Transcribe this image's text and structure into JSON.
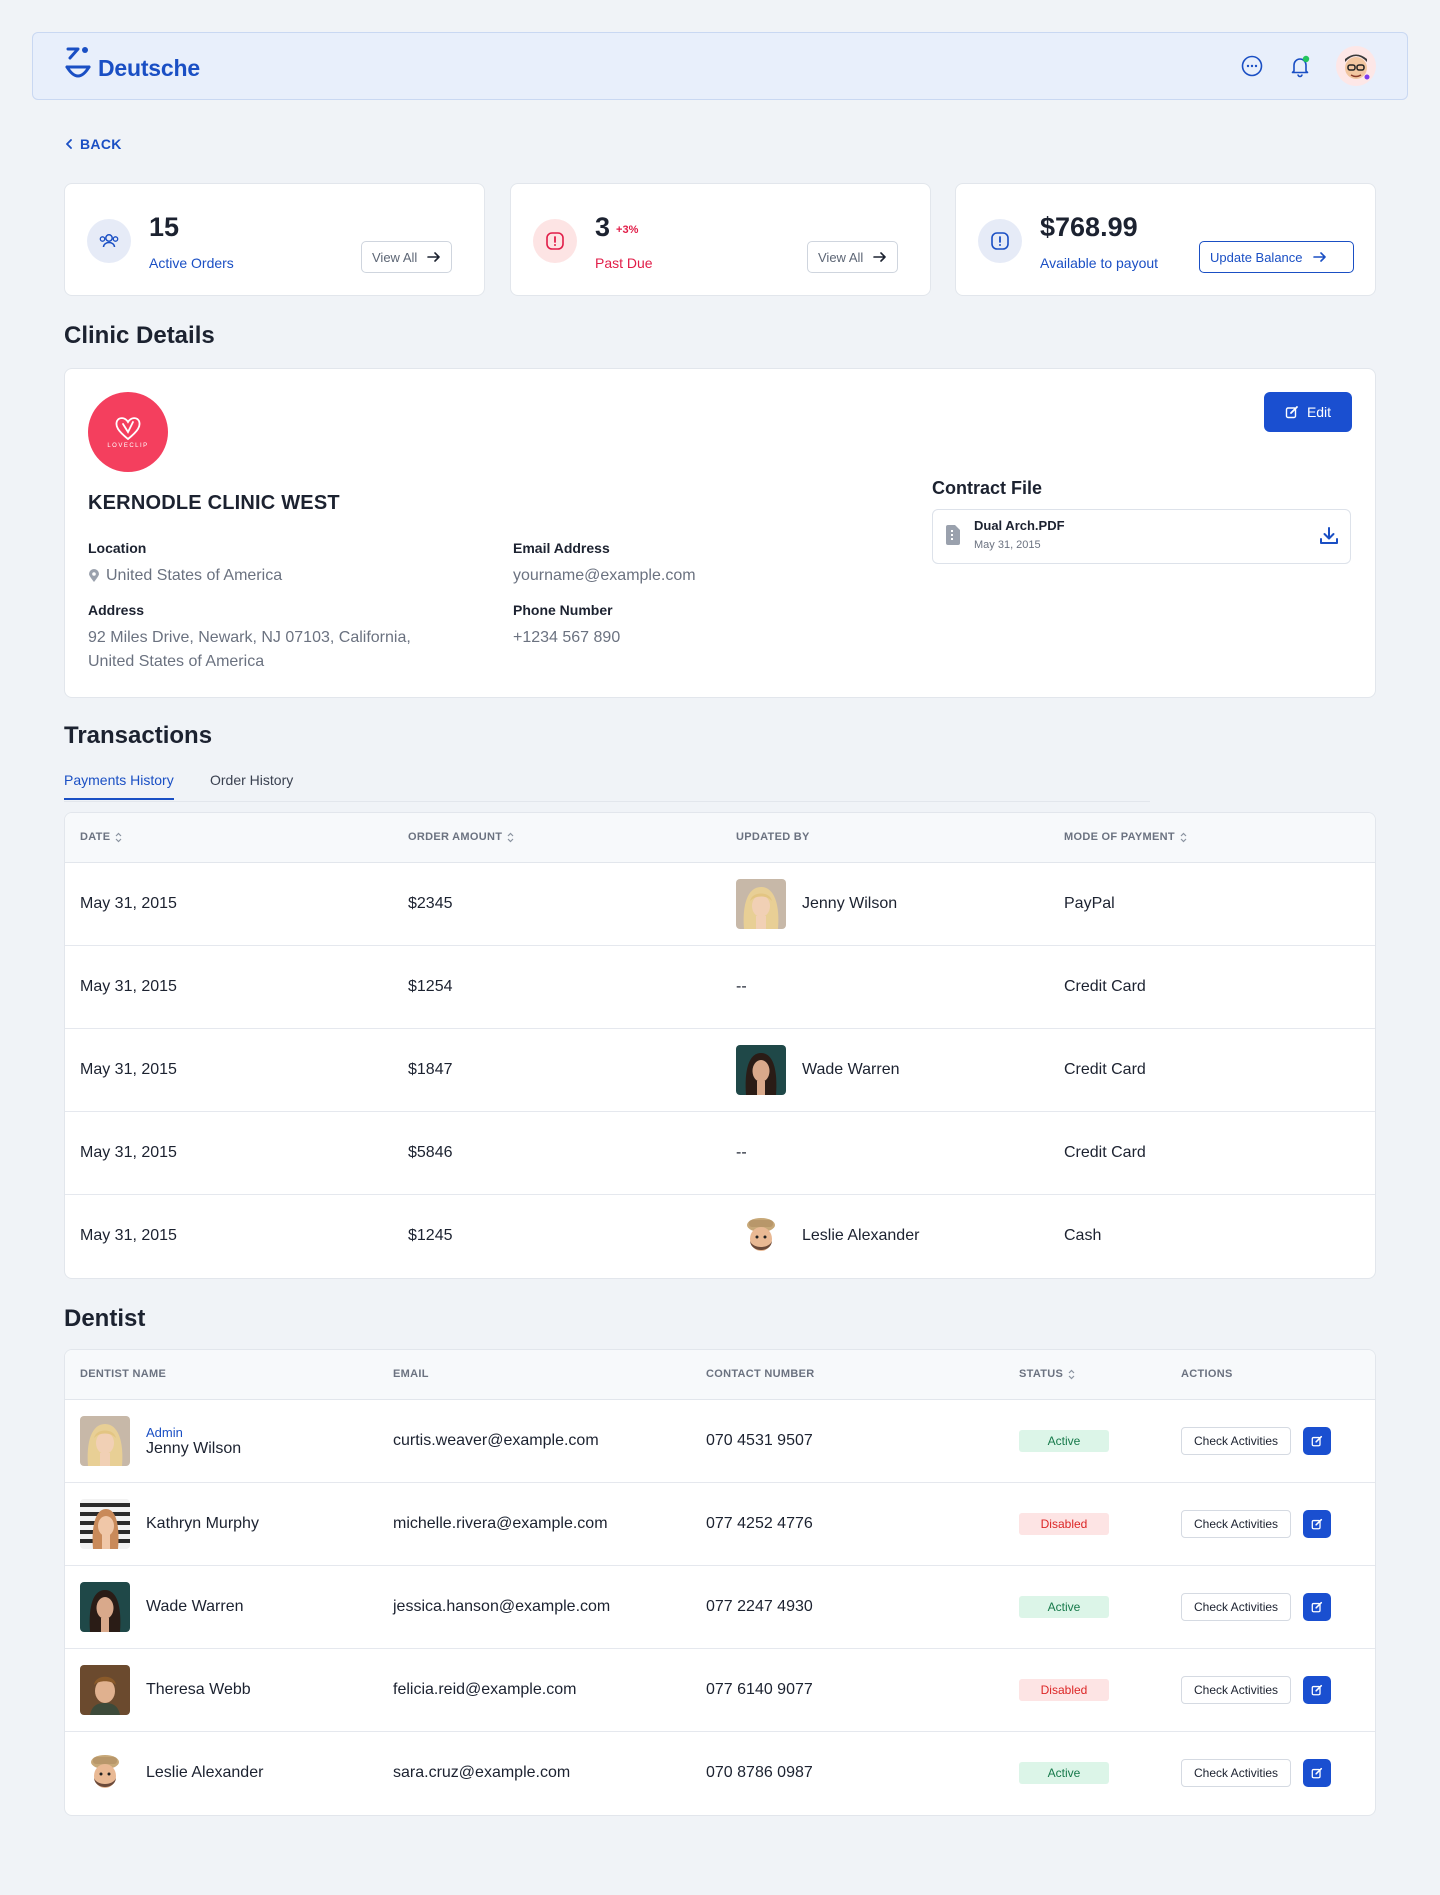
{
  "header": {
    "brand": "Deutsche"
  },
  "back_label": "BACK",
  "stats": [
    {
      "value": "15",
      "badge": "",
      "label": "Active Orders",
      "button": "View All",
      "label_color": "#1a4fc4",
      "icon_bg": "#e6ebf7"
    },
    {
      "value": "3",
      "badge": "+3%",
      "label": "Past Due",
      "button": "View All",
      "label_color": "#e11d48",
      "icon_bg": "#fde4e4"
    },
    {
      "value": "$768.99",
      "badge": "",
      "label": "Available to payout",
      "button": "Update Balance",
      "label_color": "#1a4fc4",
      "icon_bg": "#e6ebf7"
    }
  ],
  "clinic": {
    "section_title": "Clinic Details",
    "logo_text": "LOVECLIP",
    "name": "KERNODLE CLINIC WEST",
    "edit_label": "Edit",
    "location_label": "Location",
    "location": "United States of America",
    "address_label": "Address",
    "address_line1": "92 Miles Drive, Newark, NJ 07103, California,",
    "address_line2": "United States of America",
    "email_label": "Email Address",
    "email": "yourname@example.com",
    "phone_label": "Phone Number",
    "phone": "+1234 567 890",
    "contract_label": "Contract File",
    "file_name": "Dual Arch.PDF",
    "file_date": "May 31, 2015"
  },
  "transactions": {
    "section_title": "Transactions",
    "tabs": [
      "Payments History",
      "Order History"
    ],
    "columns": [
      "DATE",
      "ORDER AMOUNT",
      "UPDATED BY",
      "MODE OF PAYMENT"
    ],
    "rows": [
      {
        "date": "May 31, 2015",
        "amount": "$2345",
        "updated_by": "Jenny Wilson",
        "mode": "PayPal",
        "avatar": "blonde"
      },
      {
        "date": "May 31, 2015",
        "amount": "$1254",
        "updated_by": "--",
        "mode": "Credit Card",
        "avatar": ""
      },
      {
        "date": "May 31, 2015",
        "amount": "$1847",
        "updated_by": "Wade Warren",
        "mode": "Credit Card",
        "avatar": "dark"
      },
      {
        "date": "May 31, 2015",
        "amount": "$5846",
        "updated_by": "--",
        "mode": "Credit Card",
        "avatar": ""
      },
      {
        "date": "May 31, 2015",
        "amount": "$1245",
        "updated_by": "Leslie Alexander",
        "mode": "Cash",
        "avatar": "memoji"
      }
    ]
  },
  "dentist": {
    "section_title": "Dentist",
    "columns": [
      "DENTIST NAME",
      "EMAIL",
      "CONTACT NUMBER",
      "STATUS",
      "ACTIONS"
    ],
    "action_label": "Check Activities",
    "rows": [
      {
        "role": "Admin",
        "name": "Jenny Wilson",
        "email": "curtis.weaver@example.com",
        "phone": "070 4531 9507",
        "status": "Active",
        "avatar": "blonde"
      },
      {
        "role": "",
        "name": "Kathryn Murphy",
        "email": "michelle.rivera@example.com",
        "phone": "077 4252 4776",
        "status": "Disabled",
        "avatar": "stripes"
      },
      {
        "role": "",
        "name": "Wade Warren",
        "email": "jessica.hanson@example.com",
        "phone": "077 2247 4930",
        "status": "Active",
        "avatar": "dark"
      },
      {
        "role": "",
        "name": "Theresa Webb",
        "email": "felicia.reid@example.com",
        "phone": "077 6140 9077",
        "status": "Disabled",
        "avatar": "man"
      },
      {
        "role": "",
        "name": "Leslie Alexander",
        "email": "sara.cruz@example.com",
        "phone": "070 8786 0987",
        "status": "Active",
        "avatar": "memoji"
      }
    ]
  }
}
